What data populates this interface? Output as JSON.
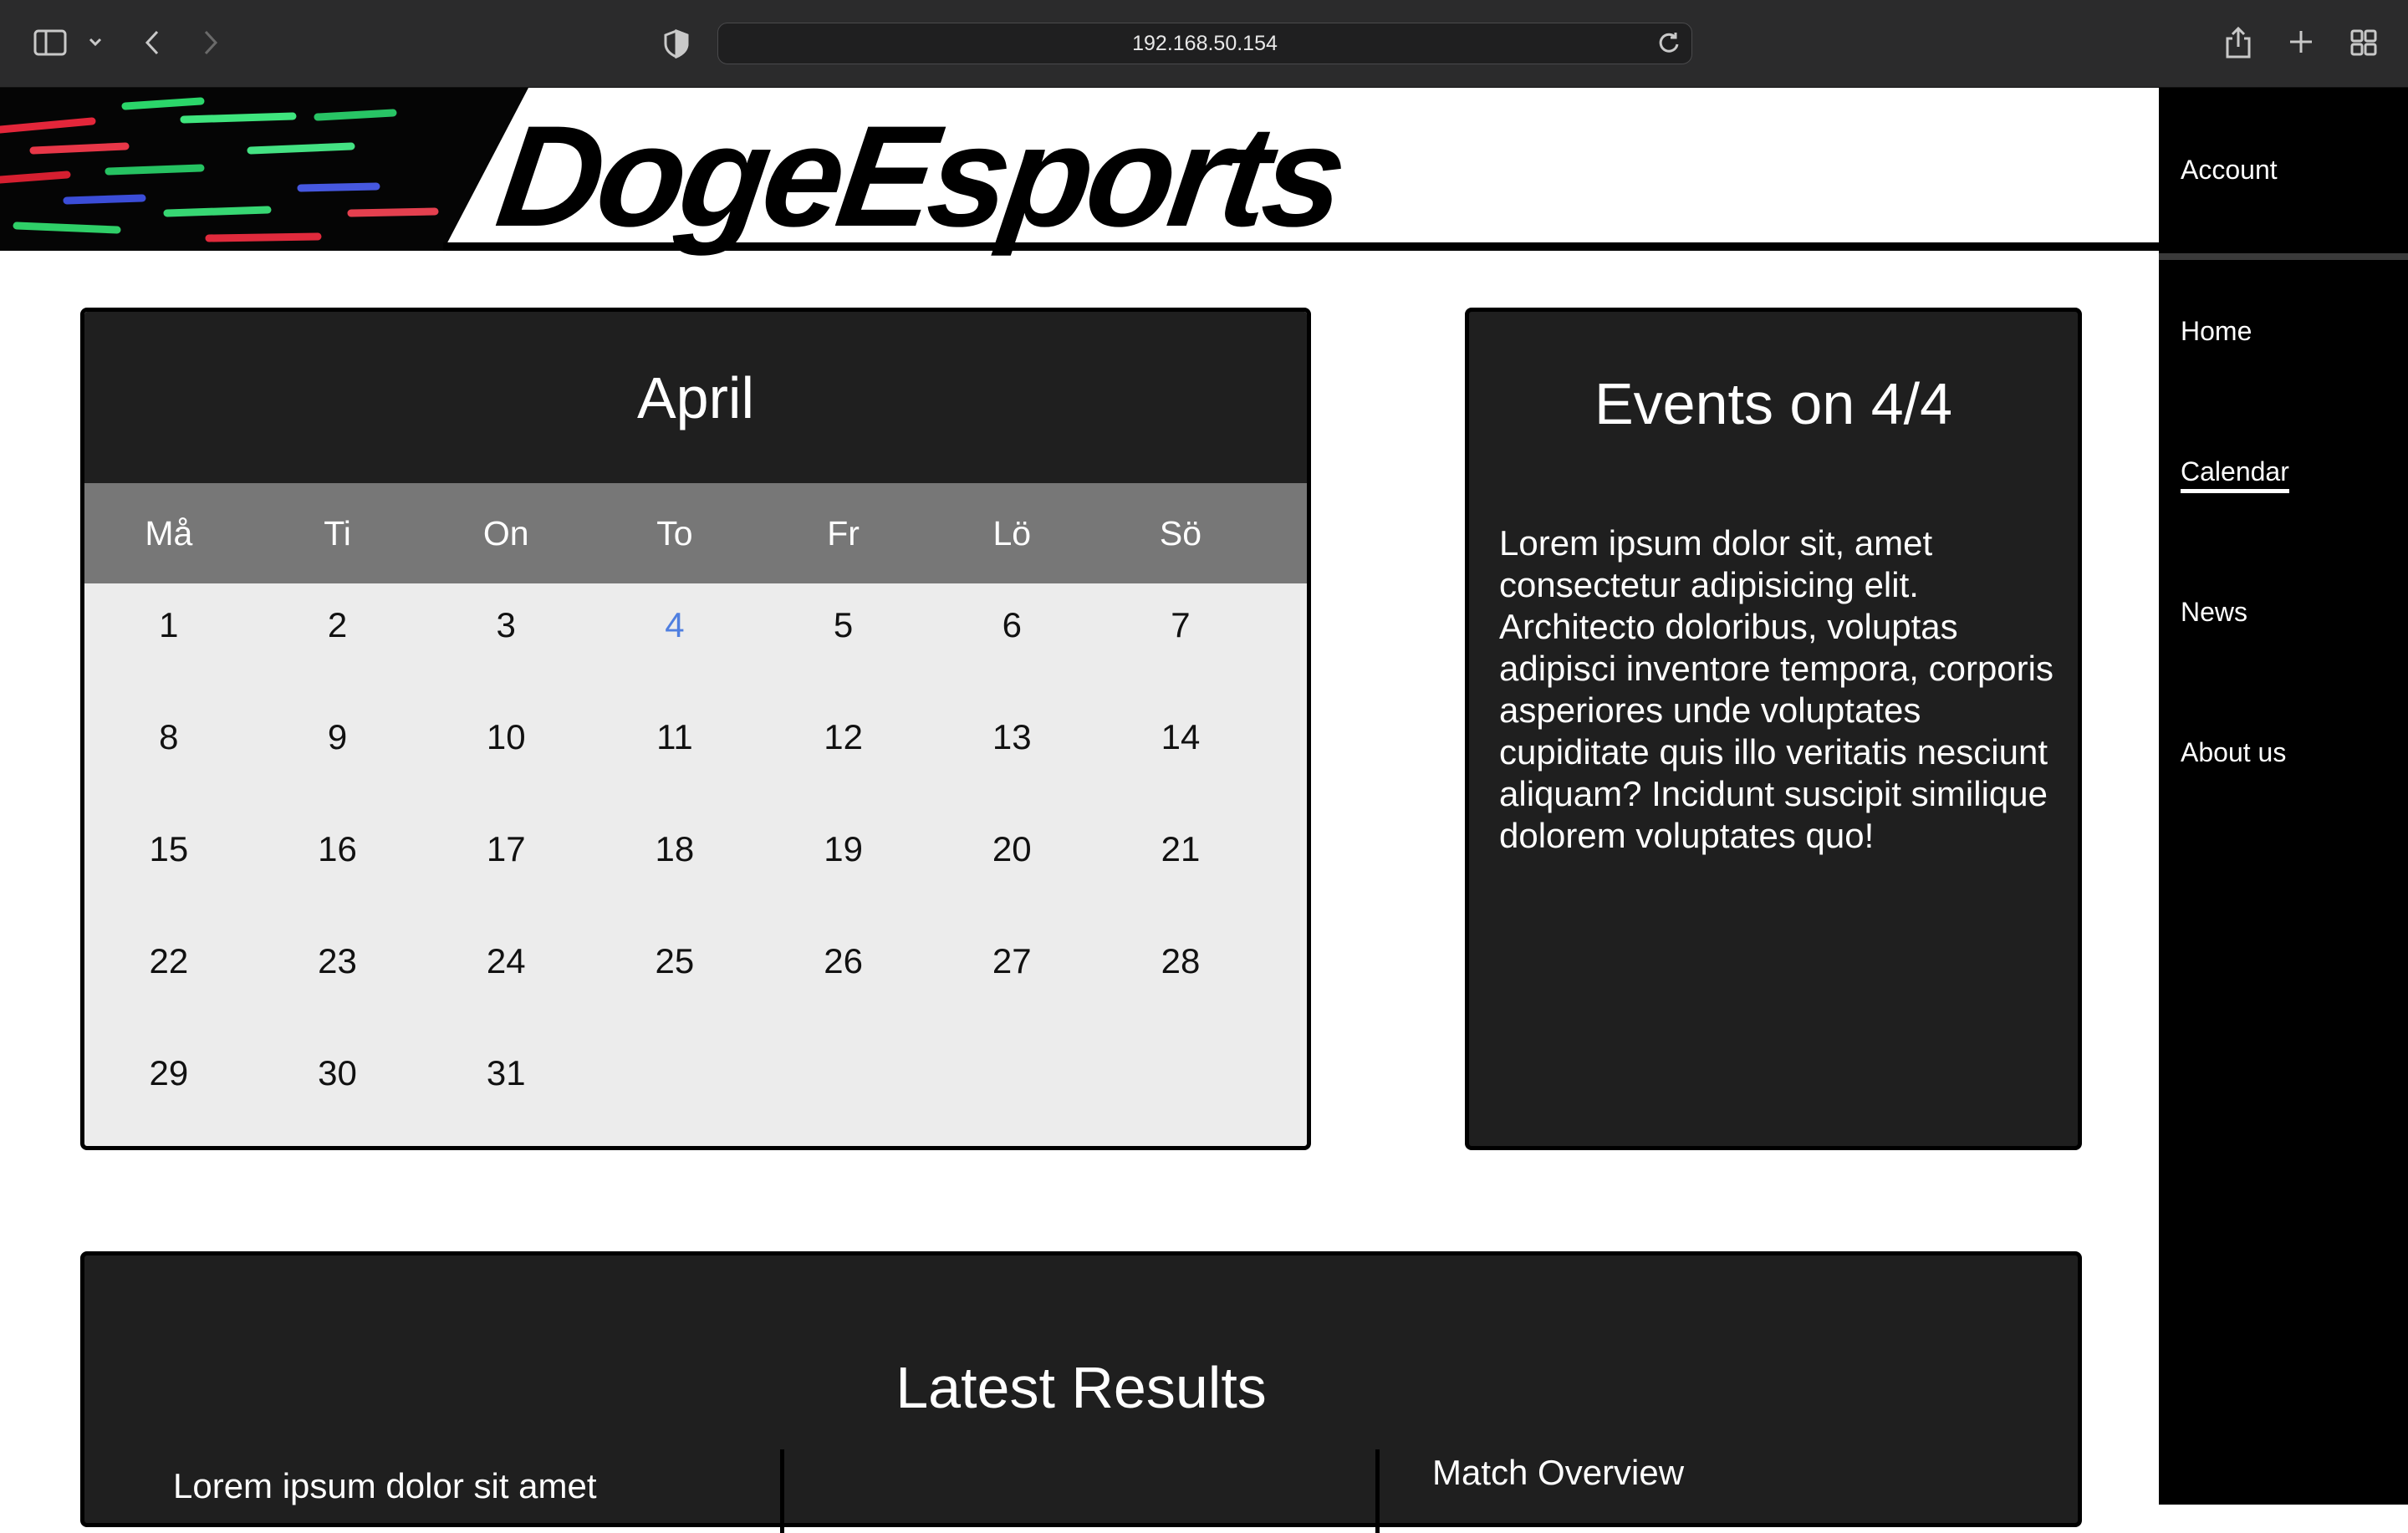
{
  "browser": {
    "url": "192.168.50.154"
  },
  "brand": {
    "logo_text": "DogeEsports"
  },
  "sidebar": {
    "account": "Account",
    "items": [
      {
        "label": "Home"
      },
      {
        "label": "Calendar",
        "active": true
      },
      {
        "label": "News"
      },
      {
        "label": "About us"
      }
    ]
  },
  "calendar": {
    "month": "April",
    "weekdays": [
      "Må",
      "Ti",
      "On",
      "To",
      "Fr",
      "Lö",
      "Sö"
    ],
    "weeks": [
      [
        "1",
        "2",
        "3",
        "4",
        "5",
        "6",
        "7"
      ],
      [
        "8",
        "9",
        "10",
        "11",
        "12",
        "13",
        "14"
      ],
      [
        "15",
        "16",
        "17",
        "18",
        "19",
        "20",
        "21"
      ],
      [
        "22",
        "23",
        "24",
        "25",
        "26",
        "27",
        "28"
      ],
      [
        "29",
        "30",
        "31",
        "",
        "",
        "",
        ""
      ]
    ],
    "selected_day": "4",
    "selected_color": "#4f7fe0"
  },
  "events": {
    "title": "Events on 4/4",
    "text": "Lorem ipsum dolor sit, amet consectetur adipisicing elit. Architecto doloribus, voluptas adipisci inventore tempora, corporis asperiores unde voluptates cupiditate quis illo veritatis nesciunt aliquam? Incidunt suscipit similique dolorem voluptates quo!"
  },
  "results": {
    "title": "Latest Results",
    "left_text": "Lorem ipsum dolor sit amet",
    "right_text": "Match Overview"
  }
}
